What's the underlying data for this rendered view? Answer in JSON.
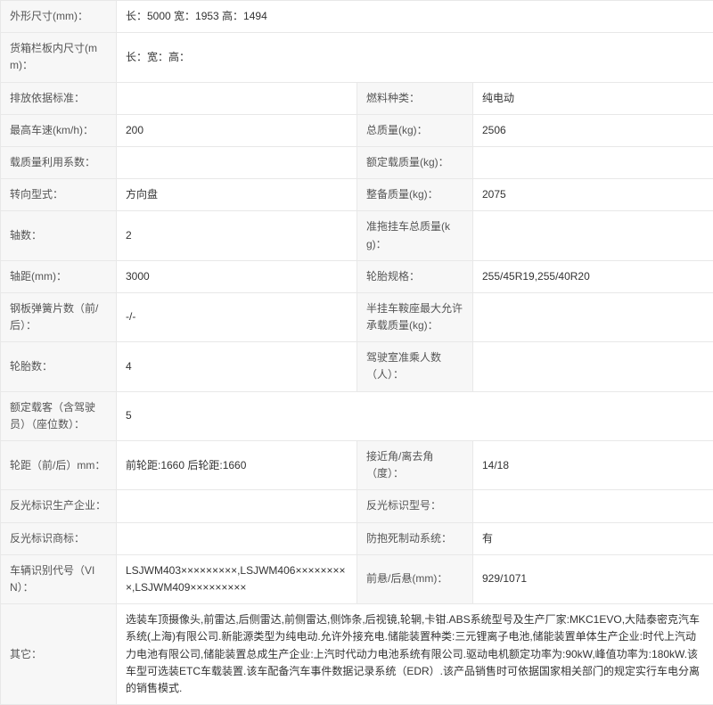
{
  "rows": [
    {
      "type": "full",
      "label": "外形尺寸(mm)：",
      "value": "长：5000 宽：1953 高：1494"
    },
    {
      "type": "full",
      "label": "货箱栏板内尺寸(mm)：",
      "value": "长：宽：高："
    },
    {
      "type": "pair",
      "l1": "排放依据标准：",
      "v1": "",
      "l2": "燃料种类：",
      "v2": "纯电动"
    },
    {
      "type": "pair",
      "l1": "最高车速(km/h)：",
      "v1": "200",
      "l2": "总质量(kg)：",
      "v2": "2506"
    },
    {
      "type": "pair",
      "l1": "载质量利用系数：",
      "v1": "",
      "l2": "额定载质量(kg)：",
      "v2": ""
    },
    {
      "type": "pair",
      "l1": "转向型式：",
      "v1": "方向盘",
      "l2": "整备质量(kg)：",
      "v2": "2075"
    },
    {
      "type": "pair",
      "l1": "轴数：",
      "v1": "2",
      "l2": "准拖挂车总质量(kg)：",
      "v2": ""
    },
    {
      "type": "pair",
      "l1": "轴距(mm)：",
      "v1": "3000",
      "l2": "轮胎规格：",
      "v2": "255/45R19,255/40R20"
    },
    {
      "type": "pair",
      "l1": "钢板弹簧片数（前/后）：",
      "v1": "-/-",
      "l2": "半挂车鞍座最大允许承载质量(kg)：",
      "v2": ""
    },
    {
      "type": "pair",
      "l1": "轮胎数：",
      "v1": "4",
      "l2": "驾驶室准乘人数（人）：",
      "v2": ""
    },
    {
      "type": "full",
      "label": "额定载客（含驾驶员）（座位数）：",
      "value": "5"
    },
    {
      "type": "pair",
      "l1": "轮距（前/后）mm：",
      "v1": "前轮距:1660 后轮距:1660",
      "l2": "接近角/离去角（度）：",
      "v2": "14/18"
    },
    {
      "type": "pair",
      "l1": "反光标识生产企业：",
      "v1": "",
      "l2": "反光标识型号：",
      "v2": ""
    },
    {
      "type": "pair",
      "l1": "反光标识商标：",
      "v1": "",
      "l2": "防抱死制动系统：",
      "v2": "有"
    },
    {
      "type": "pair",
      "l1": "车辆识别代号（VIN）：",
      "v1": "LSJWM403×××××××××,LSJWM406×××××××××,LSJWM409×××××××××",
      "l2": "前悬/后悬(mm)：",
      "v2": "929/1071"
    },
    {
      "type": "full",
      "label": "其它：",
      "value": "选装车顶摄像头,前雷达,后侧雷达,前侧雷达,侧饰条,后视镜,轮辋,卡钳.ABS系统型号及生产厂家:MKC1EVO,大陆泰密克汽车系统(上海)有限公司.新能源类型为纯电动.允许外接充电.储能装置种类:三元锂离子电池,储能装置单体生产企业:时代上汽动力电池有限公司,储能装置总成生产企业:上汽时代动力电池系统有限公司.驱动电机额定功率为:90kW,峰值功率为:180kW.该车型可选装ETC车载装置.该车配备汽车事件数据记录系统（EDR）.该产品销售时可依据国家相关部门的规定实行车电分离的销售模式."
    }
  ]
}
